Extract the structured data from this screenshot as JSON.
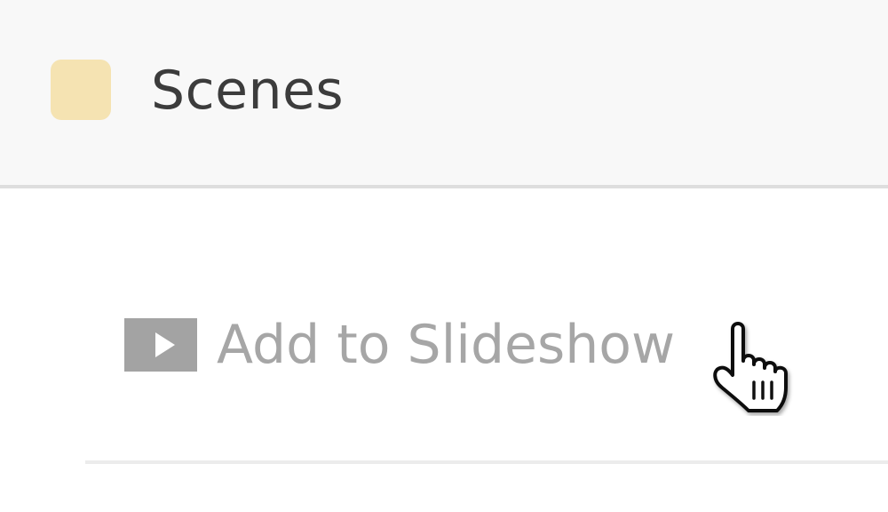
{
  "header": {
    "title": "Scenes",
    "swatch_color": "#f5e3b2"
  },
  "menu": {
    "add_to_slideshow_label": "Add to Slideshow",
    "icon": "play-icon"
  },
  "cursor": {
    "icon": "hand-pointer-icon"
  }
}
